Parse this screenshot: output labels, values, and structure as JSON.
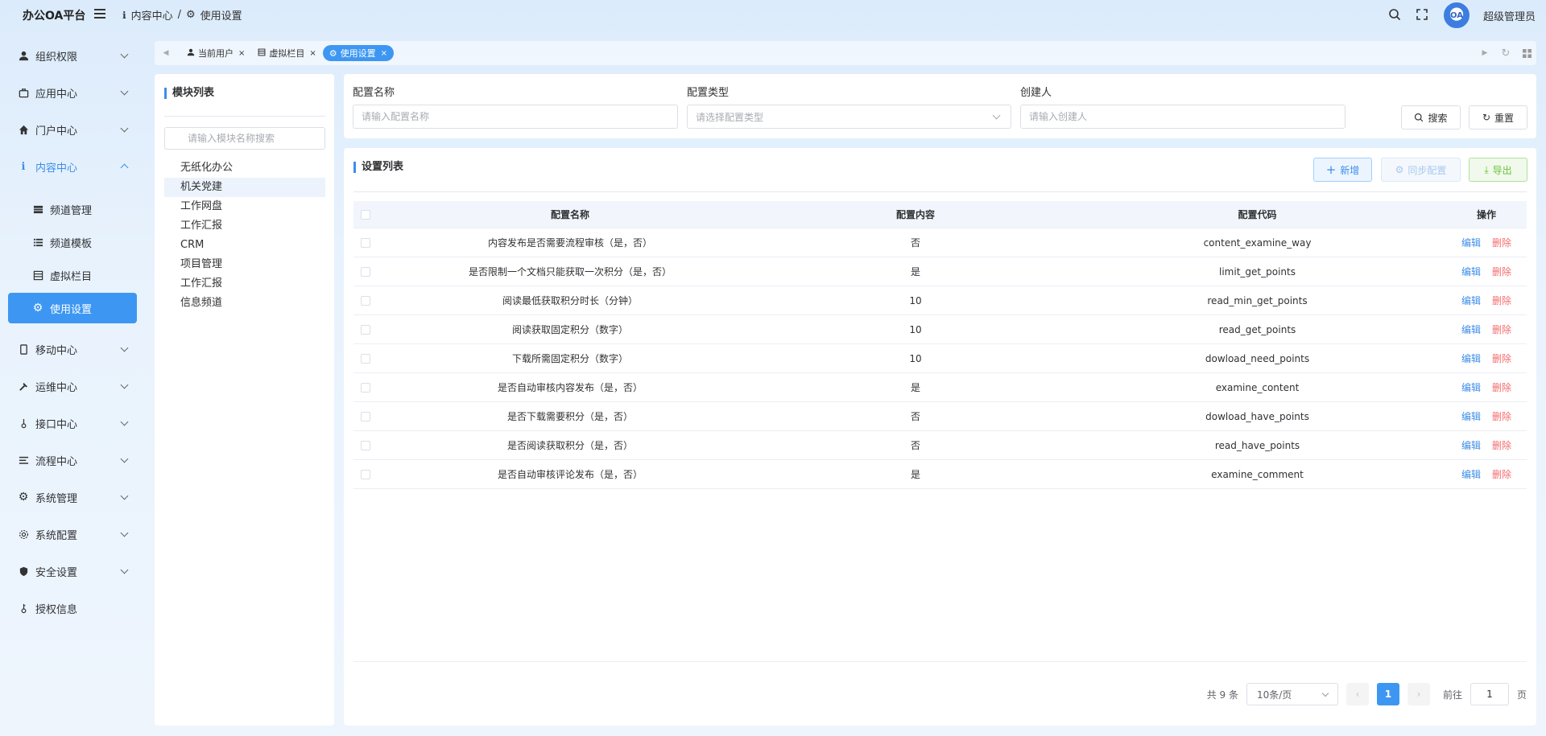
{
  "header": {
    "logo": "办公OA平台",
    "breadcrumb": [
      "内容中心",
      "/",
      "使用设置"
    ],
    "avatar_text": "OA",
    "username": "超级管理员"
  },
  "sidebar": {
    "items": [
      {
        "label": "组织权限",
        "icon": "user-icon"
      },
      {
        "label": "应用中心",
        "icon": "briefcase-icon"
      },
      {
        "label": "门户中心",
        "icon": "home-icon"
      },
      {
        "label": "内容中心",
        "icon": "info-icon",
        "open": true
      },
      {
        "label": "频道管理",
        "icon": "channel-icon",
        "sub": true
      },
      {
        "label": "频道模板",
        "icon": "template-icon",
        "sub": true
      },
      {
        "label": "虚拟栏目",
        "icon": "column-icon",
        "sub": true
      },
      {
        "label": "使用设置",
        "icon": "gear-icon",
        "sub": true,
        "active": true
      },
      {
        "label": "移动中心",
        "icon": "mobile-icon"
      },
      {
        "label": "运维中心",
        "icon": "hammer-icon"
      },
      {
        "label": "接口中心",
        "icon": "plug-icon"
      },
      {
        "label": "流程中心",
        "icon": "flow-icon"
      },
      {
        "label": "系统管理",
        "icon": "gear-icon"
      },
      {
        "label": "系统配置",
        "icon": "cog-icon"
      },
      {
        "label": "安全设置",
        "icon": "shield-icon"
      },
      {
        "label": "授权信息",
        "icon": "key-icon"
      }
    ]
  },
  "tabs": [
    {
      "label": "当前用户",
      "close": "×"
    },
    {
      "label": "虚拟栏目",
      "close": "×"
    },
    {
      "label": "使用设置",
      "close": "×",
      "active": true
    }
  ],
  "modules": {
    "title": "模块列表",
    "search_placeholder": "请输入模块名称搜索",
    "items": [
      "无纸化办公",
      "机关党建",
      "工作网盘",
      "工作汇报",
      "CRM",
      "项目管理",
      "工作汇报",
      "信息频道"
    ],
    "selected_index": 1
  },
  "filters": {
    "name_label": "配置名称",
    "name_placeholder": "请输入配置名称",
    "type_label": "配置类型",
    "type_placeholder": "请选择配置类型",
    "creator_label": "创建人",
    "creator_placeholder": "请输入创建人",
    "search_btn": "搜索",
    "reset_btn": "重置"
  },
  "list": {
    "title": "设置列表",
    "add_btn": "新增",
    "sync_btn": "同步配置",
    "export_btn": "导出",
    "columns": [
      "配置名称",
      "配置内容",
      "配置代码",
      "操作"
    ],
    "edit_label": "编辑",
    "delete_label": "删除",
    "rows": [
      {
        "name": "内容发布是否需要流程审核（是，否）",
        "content": "否",
        "code": "content_examine_way"
      },
      {
        "name": "是否限制一个文档只能获取一次积分（是，否）",
        "content": "是",
        "code": "limit_get_points"
      },
      {
        "name": "阅读最低获取积分时长（分钟）",
        "content": "10",
        "code": "read_min_get_points"
      },
      {
        "name": "阅读获取固定积分（数字）",
        "content": "10",
        "code": "read_get_points"
      },
      {
        "name": "下载所需固定积分（数字）",
        "content": "10",
        "code": "dowload_need_points"
      },
      {
        "name": "是否自动审核内容发布（是，否）",
        "content": "是",
        "code": "examine_content"
      },
      {
        "name": "是否下载需要积分（是，否）",
        "content": "否",
        "code": "dowload_have_points"
      },
      {
        "name": "是否阅读获取积分（是，否）",
        "content": "否",
        "code": "read_have_points"
      },
      {
        "name": "是否自动审核评论发布（是，否）",
        "content": "是",
        "code": "examine_comment"
      }
    ]
  },
  "pager": {
    "total": "共 9 条",
    "page_size": "10条/页",
    "current": "1",
    "goto_prefix": "前往",
    "goto_value": "1",
    "goto_suffix": "页"
  },
  "colors": {
    "accent": "#3d97f2",
    "danger": "#f56c6c",
    "export": "#67c23a"
  }
}
